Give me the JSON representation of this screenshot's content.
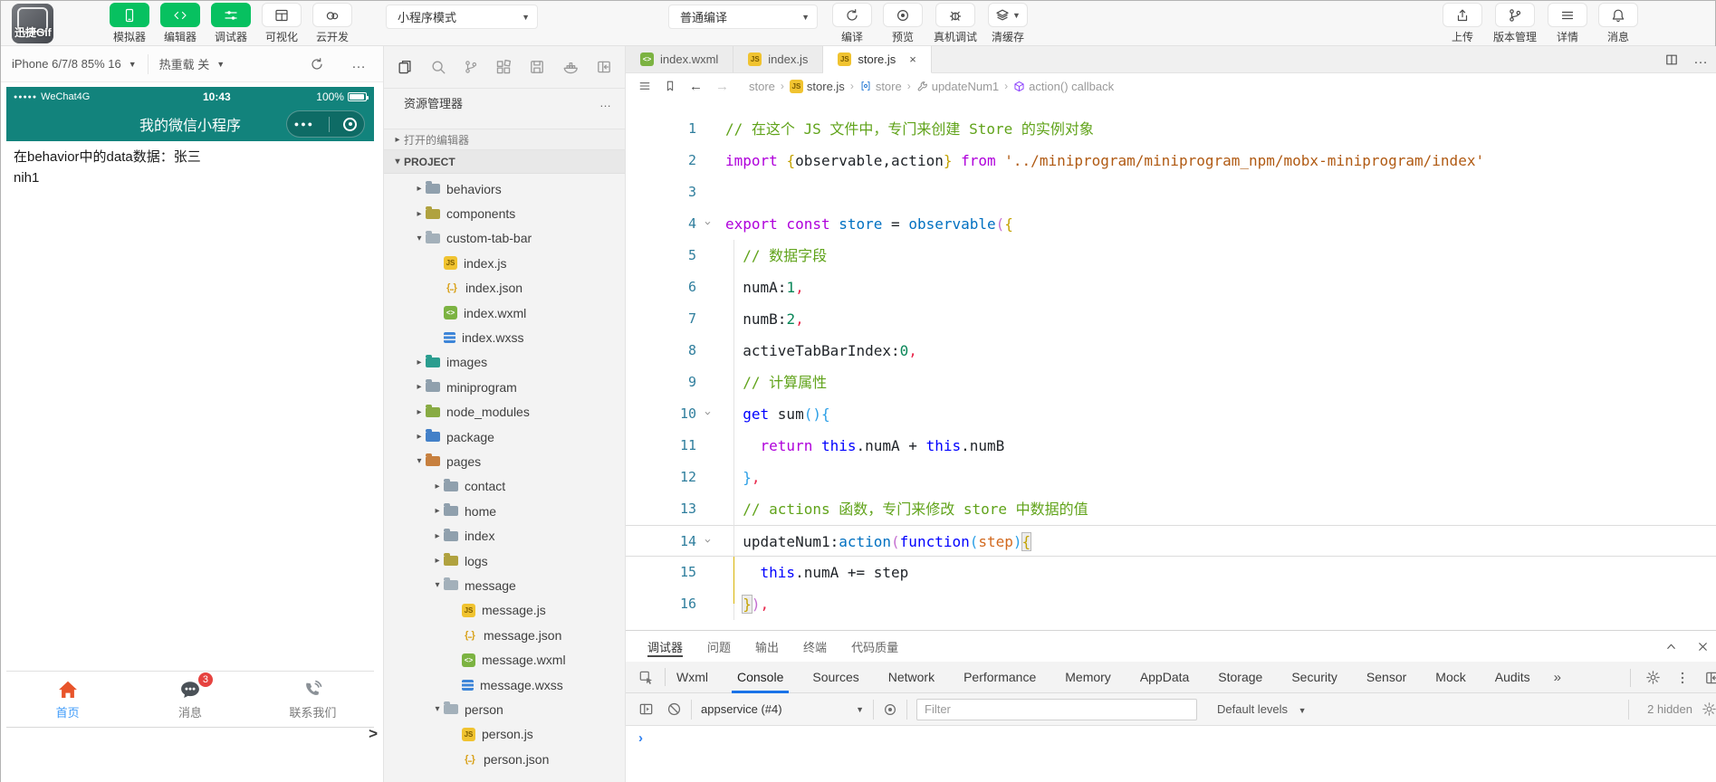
{
  "toolbar": {
    "avatar_watermark": "迅捷Gif",
    "mode_buttons": [
      {
        "label": "模拟器",
        "icon": "phone-icon",
        "style": "green"
      },
      {
        "label": "编辑器",
        "icon": "code-icon",
        "style": "green"
      },
      {
        "label": "调试器",
        "icon": "sliders-icon",
        "style": "green"
      },
      {
        "label": "可视化",
        "icon": "layout-icon",
        "style": "white"
      },
      {
        "label": "云开发",
        "icon": "cloud-icon",
        "style": "white"
      }
    ],
    "mode_select": "小程序模式",
    "compile_select": "普通编译",
    "action_buttons": [
      {
        "label": "编译",
        "icon": "refresh-icon"
      },
      {
        "label": "预览",
        "icon": "eye-icon"
      },
      {
        "label": "真机调试",
        "icon": "bug-icon"
      },
      {
        "label": "清缓存",
        "icon": "layers-icon",
        "caret": true
      }
    ],
    "right_buttons": [
      {
        "label": "上传",
        "icon": "upload-icon"
      },
      {
        "label": "版本管理",
        "icon": "branch-icon"
      },
      {
        "label": "详情",
        "icon": "menu-icon"
      },
      {
        "label": "消息",
        "icon": "bell-icon"
      }
    ]
  },
  "simulator": {
    "device_select": "iPhone 6/7/8 85% 16",
    "hot_reload": "热重载 关",
    "collapse_handle": ">",
    "phone": {
      "carrier": "WeChat4G",
      "time": "10:43",
      "battery": "100%",
      "nav_title": "我的微信小程序",
      "content_lines": [
        "在behavior中的data数据：张三",
        "nih1"
      ],
      "tabbar": [
        {
          "label": "首页",
          "icon": "home-icon",
          "active": true
        },
        {
          "label": "消息",
          "icon": "chat-icon",
          "badge": "3"
        },
        {
          "label": "联系我们",
          "icon": "telephone-icon"
        }
      ]
    }
  },
  "explorer": {
    "title": "资源管理器",
    "open_editors": "打开的编辑器",
    "project": "PROJECT",
    "tree": [
      {
        "name": "behaviors",
        "icon": "folder gray",
        "arrow": "r",
        "d": 1
      },
      {
        "name": "components",
        "icon": "folder olive",
        "arrow": "r",
        "d": 1
      },
      {
        "name": "custom-tab-bar",
        "icon": "folder gray open",
        "arrow": "d",
        "d": 1
      },
      {
        "name": "index.js",
        "icon": "js",
        "d": 2
      },
      {
        "name": "index.json",
        "icon": "json",
        "d": 2
      },
      {
        "name": "index.wxml",
        "icon": "wxml",
        "d": 2
      },
      {
        "name": "index.wxss",
        "icon": "wxss",
        "d": 2
      },
      {
        "name": "images",
        "icon": "folder teal",
        "arrow": "r",
        "d": 1
      },
      {
        "name": "miniprogram",
        "icon": "folder gray",
        "arrow": "r",
        "d": 1
      },
      {
        "name": "node_modules",
        "icon": "folder green",
        "arrow": "r",
        "d": 1
      },
      {
        "name": "package",
        "icon": "folder blue",
        "arrow": "r",
        "d": 1
      },
      {
        "name": "pages",
        "icon": "folder orange",
        "arrow": "d",
        "d": 1
      },
      {
        "name": "contact",
        "icon": "folder gray",
        "arrow": "r",
        "d": 2
      },
      {
        "name": "home",
        "icon": "folder gray",
        "arrow": "r",
        "d": 2
      },
      {
        "name": "index",
        "icon": "folder gray",
        "arrow": "r",
        "d": 2
      },
      {
        "name": "logs",
        "icon": "folder olive",
        "arrow": "r",
        "d": 2
      },
      {
        "name": "message",
        "icon": "folder gray open",
        "arrow": "d",
        "d": 2
      },
      {
        "name": "message.js",
        "icon": "js",
        "d": 3
      },
      {
        "name": "message.json",
        "icon": "json",
        "d": 3
      },
      {
        "name": "message.wxml",
        "icon": "wxml",
        "d": 3
      },
      {
        "name": "message.wxss",
        "icon": "wxss",
        "d": 3
      },
      {
        "name": "person",
        "icon": "folder gray open",
        "arrow": "d",
        "d": 2
      },
      {
        "name": "person.js",
        "icon": "js",
        "d": 3
      },
      {
        "name": "person.json",
        "icon": "json",
        "d": 3
      }
    ]
  },
  "editor": {
    "tabs": [
      {
        "name": "index.wxml",
        "icon": "wxml"
      },
      {
        "name": "index.js",
        "icon": "js"
      },
      {
        "name": "store.js",
        "icon": "js",
        "active": true
      }
    ],
    "breadcrumb": [
      {
        "label": "store"
      },
      {
        "label": "store.js",
        "icon": "js",
        "strong": true
      },
      {
        "label": "store",
        "icon": "var"
      },
      {
        "label": "updateNum1",
        "icon": "method"
      },
      {
        "label": "action() callback",
        "icon": "event"
      }
    ],
    "code": [
      {
        "n": 1,
        "t": [
          [
            "cm",
            "// 在这个 JS 文件中，专门来创建 Store 的实例对象"
          ]
        ]
      },
      {
        "n": 2,
        "t": [
          [
            "kw",
            "import "
          ],
          [
            "b1",
            "{"
          ],
          [
            "pl",
            "observable,action"
          ],
          [
            "b1",
            "}"
          ],
          [
            "kw",
            " from "
          ],
          [
            "str",
            "'../miniprogram/miniprogram_npm/mobx-miniprogram/index'"
          ]
        ]
      },
      {
        "n": 3,
        "t": []
      },
      {
        "n": 4,
        "fold": true,
        "t": [
          [
            "kw",
            "export const "
          ],
          [
            "vr",
            "store"
          ],
          [
            "pl",
            " = "
          ],
          [
            "fn",
            "observable"
          ],
          [
            "b2",
            "("
          ],
          [
            "b1",
            "{"
          ]
        ]
      },
      {
        "n": 5,
        "t": [
          [
            "pl",
            "  "
          ],
          [
            "cm",
            "// 数据字段"
          ]
        ]
      },
      {
        "n": 6,
        "t": [
          [
            "pl",
            "  numA:"
          ],
          [
            "num",
            "1"
          ],
          [
            "cma",
            ","
          ]
        ]
      },
      {
        "n": 7,
        "t": [
          [
            "pl",
            "  numB:"
          ],
          [
            "num",
            "2"
          ],
          [
            "cma",
            ","
          ]
        ]
      },
      {
        "n": 8,
        "t": [
          [
            "pl",
            "  activeTabBarIndex:"
          ],
          [
            "num",
            "0"
          ],
          [
            "cma",
            ","
          ]
        ]
      },
      {
        "n": 9,
        "t": [
          [
            "pl",
            "  "
          ],
          [
            "cm",
            "// 计算属性"
          ]
        ]
      },
      {
        "n": 10,
        "fold": true,
        "t": [
          [
            "pl",
            "  "
          ],
          [
            "kb",
            "get "
          ],
          [
            "pl",
            "sum"
          ],
          [
            "b3",
            "(){"
          ]
        ]
      },
      {
        "n": 11,
        "t": [
          [
            "pl",
            "    "
          ],
          [
            "kw",
            "return "
          ],
          [
            "kb",
            "this"
          ],
          [
            "pl",
            ".numA + "
          ],
          [
            "kb",
            "this"
          ],
          [
            "pl",
            ".numB"
          ]
        ]
      },
      {
        "n": 12,
        "t": [
          [
            "pl",
            "  "
          ],
          [
            "b3",
            "}"
          ],
          [
            "cma",
            ","
          ]
        ]
      },
      {
        "n": 13,
        "t": [
          [
            "pl",
            "  "
          ],
          [
            "cm",
            "// actions 函数，专门来修改 store 中数据的值"
          ]
        ]
      },
      {
        "n": 14,
        "fold": true,
        "cur": true,
        "t": [
          [
            "pl",
            "  updateNum1:"
          ],
          [
            "fn",
            "action"
          ],
          [
            "b2",
            "("
          ],
          [
            "kb",
            "function"
          ],
          [
            "b3",
            "("
          ],
          [
            "pr",
            "step"
          ],
          [
            "b3",
            ")"
          ],
          [
            "b1 mk",
            "{"
          ]
        ]
      },
      {
        "n": 15,
        "t": [
          [
            "pl",
            "    "
          ],
          [
            "kb",
            "this"
          ],
          [
            "pl",
            ".numA += step"
          ]
        ]
      },
      {
        "n": 16,
        "t": [
          [
            "pl",
            "  "
          ],
          [
            "b1 mk",
            "}"
          ],
          [
            "b2",
            ")"
          ],
          [
            "cma",
            ","
          ]
        ]
      }
    ]
  },
  "debug": {
    "panel_tabs": [
      {
        "label": "调试器",
        "active": true
      },
      {
        "label": "问题"
      },
      {
        "label": "输出"
      },
      {
        "label": "终端"
      },
      {
        "label": "代码质量"
      }
    ],
    "devtools_tabs": [
      {
        "label": "Wxml"
      },
      {
        "label": "Console",
        "active": true
      },
      {
        "label": "Sources"
      },
      {
        "label": "Network"
      },
      {
        "label": "Performance"
      },
      {
        "label": "Memory"
      },
      {
        "label": "AppData"
      },
      {
        "label": "Storage"
      },
      {
        "label": "Security"
      },
      {
        "label": "Sensor"
      },
      {
        "label": "Mock"
      },
      {
        "label": "Audits"
      }
    ],
    "more_tabs_glyph": "»",
    "context_select": "appservice (#4)",
    "filter_placeholder": "Filter",
    "levels_select": "Default levels",
    "hidden_count": "2 hidden",
    "prompt": "›"
  }
}
